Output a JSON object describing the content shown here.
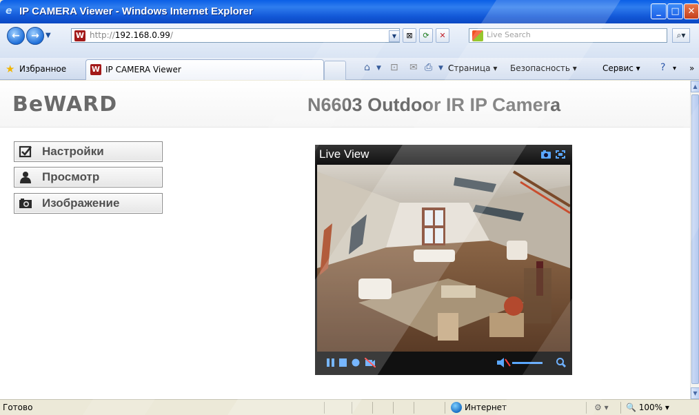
{
  "window": {
    "title": "IP CAMERA Viewer - Windows Internet Explorer"
  },
  "address_bar": {
    "url_prefix": "http://",
    "url_host": "192.168.0.99",
    "url_suffix": "/",
    "search_placeholder": "Live Search"
  },
  "favorites_bar": {
    "favorites_label": "Избранное",
    "tab_label": "IP CAMERA Viewer"
  },
  "command_bar": {
    "page_label": "Страница",
    "safety_label": "Безопасность",
    "tools_label": "Сервис"
  },
  "page": {
    "logo": "BeWARD",
    "camera_title": "N6603 Outdoor IR IP Camera",
    "menu": [
      {
        "label": "Настройки",
        "icon": "checkbox-icon"
      },
      {
        "label": "Просмотр",
        "icon": "person-icon"
      },
      {
        "label": "Изображение",
        "icon": "camera-icon"
      }
    ],
    "player": {
      "title": "Live View",
      "header_icons": [
        "snapshot-icon",
        "fullscreen-icon"
      ],
      "controls": [
        "pause-icon",
        "stop-icon",
        "record-icon",
        "mute-video-icon",
        "volume-icon",
        "zoom-icon"
      ]
    }
  },
  "status_bar": {
    "status": "Готово",
    "zone": "Интернет",
    "zoom": "100%"
  },
  "colors": {
    "titlebar": "#0a5fe6",
    "logo": "#6a6a6a",
    "player_bg": "#111111",
    "control_blue": "#5aa7ff"
  }
}
